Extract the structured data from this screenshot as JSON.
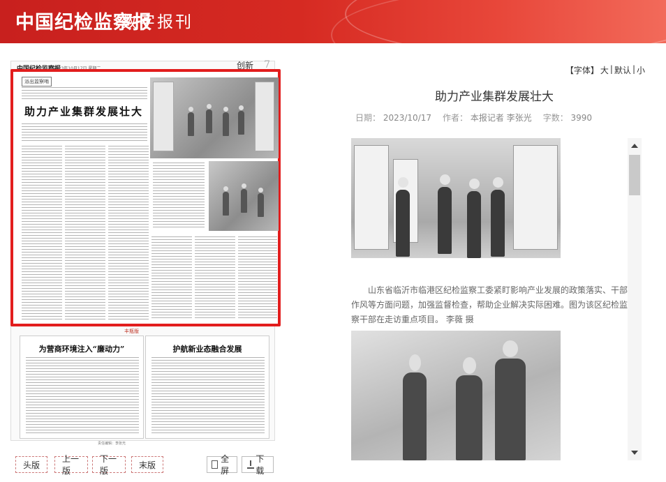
{
  "header": {
    "brand": "中国纪检监察报",
    "subtitle": "数字报刊",
    "accent": "#d62a22"
  },
  "paper": {
    "logo": "中国纪检监察报",
    "date": "2023年10月17日 星期二",
    "section": "创新",
    "page_num": "7",
    "kicker": "派出监察哨",
    "headline": "助力产业集群发展壮大",
    "lower_label": "丰瓶版",
    "lower_left_title": "为营商环境注入“廉动力”",
    "lower_right_title": "护航新业态融合发展",
    "footer": "责任编辑：李张光"
  },
  "nav": {
    "first": "头版",
    "prev": "上一版",
    "next": "下一版",
    "last": "末版",
    "fullscreen": "全屏",
    "download": "下载"
  },
  "font_controls": {
    "label": "【字体】",
    "large": "大",
    "sep1": "|",
    "default": "默认",
    "sep2": "|",
    "small": "小"
  },
  "article": {
    "title": "助力产业集群发展壮大",
    "date_label": "日期：",
    "date": "2023/10/17",
    "author_label": "作者：",
    "author": "本报记者 李张光",
    "words_label": "字数：",
    "words": "3990",
    "caption": "山东省临沂市临港区纪检监察工委紧盯影响产业发展的政策落实、干部作风等方面问题，加强监督检查，帮助企业解决实际困难。图为该区纪检监察干部在走访重点项目。 李薇 摄"
  },
  "icons": {
    "fullscreen": "fullscreen-icon",
    "download": "download-icon",
    "scroll_up": "arrow-up-icon",
    "scroll_down": "arrow-down-icon"
  }
}
